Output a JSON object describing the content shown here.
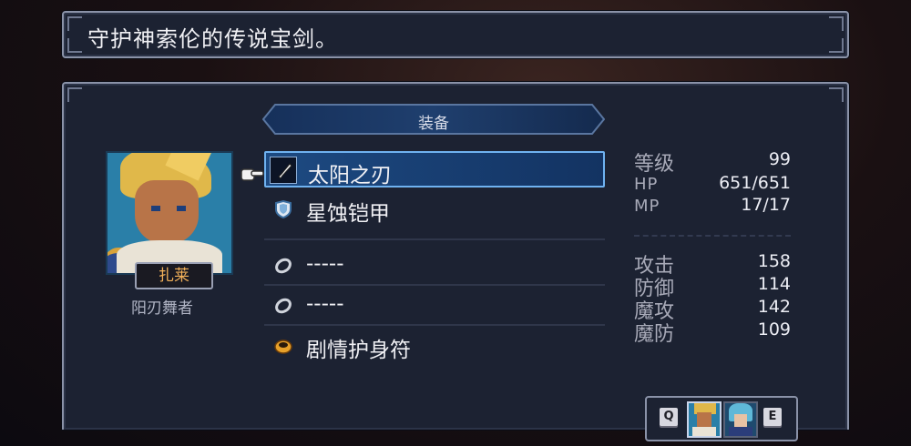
{
  "description": {
    "text": "守护神索伦的传说宝剑。"
  },
  "equipment": {
    "header": "装备",
    "slots": [
      {
        "label": "太阳之刃",
        "icon": "sword-icon",
        "selected": true
      },
      {
        "label": "星蚀铠甲",
        "icon": "armor-icon",
        "selected": false
      },
      {
        "label": "-----",
        "icon": "ring-icon",
        "selected": false
      },
      {
        "label": "-----",
        "icon": "ring-icon",
        "selected": false
      },
      {
        "label": "剧情护身符",
        "icon": "amulet-icon",
        "selected": false
      }
    ]
  },
  "character": {
    "name": "扎莱",
    "job": "阳刃舞者"
  },
  "stats": {
    "level_label": "等级",
    "level": "99",
    "hp_label": "HP",
    "hp": "651/651",
    "mp_label": "MP",
    "mp": "17/17",
    "atk_label": "攻击",
    "atk": "158",
    "def_label": "防御",
    "def": "114",
    "matk_label": "魔攻",
    "matk": "142",
    "mdef_label": "魔防",
    "mdef": "109"
  },
  "party": {
    "prev_key": "Q",
    "next_key": "E"
  },
  "colors": {
    "panel_bg": "#1c2232",
    "panel_border": "#8a92a8",
    "selected_bg": "#1d4a82",
    "name_color": "#f4b25a"
  }
}
